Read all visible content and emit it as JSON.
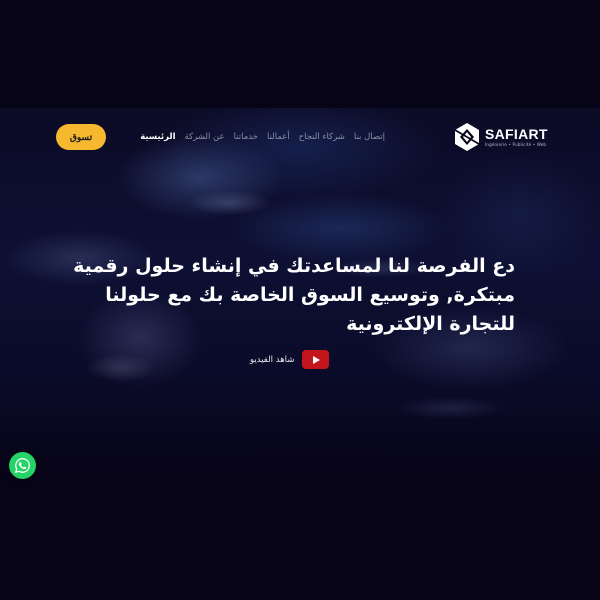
{
  "header": {
    "logo": {
      "name": "SAFIART",
      "tagline": "Ingénierie • Publicité • Web"
    },
    "nav": [
      {
        "label": "الرئيسية",
        "active": true
      },
      {
        "label": "عن الشركة",
        "active": false
      },
      {
        "label": "خدماتنا",
        "active": false
      },
      {
        "label": "أعمالنا",
        "active": false
      },
      {
        "label": "شركاء النجاح",
        "active": false
      },
      {
        "label": "إتصال بنا",
        "active": false
      }
    ],
    "shop_button": "تسوق"
  },
  "hero": {
    "headline": "دع الفرصة لنا لمساعدتك في إنشاء حلول رقمية مبتكرة, وتوسيع السوق الخاصة بك مع حلولنا للتجارة الإلكترونية",
    "video_link": "شاهد الفيديو"
  },
  "floating": {
    "whatsapp_icon": "whatsapp-icon"
  },
  "colors": {
    "background": "#070418",
    "accent": "#f5b82e",
    "youtube": "#c4151c",
    "whatsapp": "#25d366"
  }
}
